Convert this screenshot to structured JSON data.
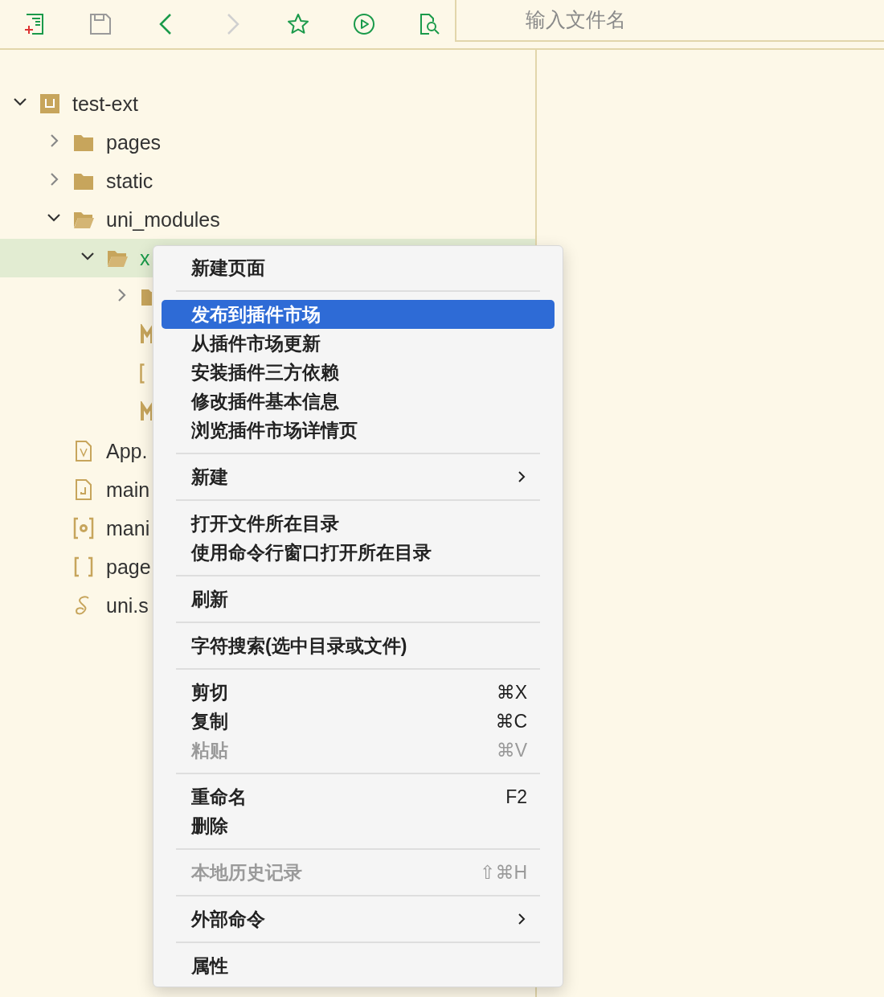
{
  "toolbar": {
    "buttons": [
      {
        "kind": "new-file",
        "disabled": false
      },
      {
        "kind": "save",
        "disabled": true
      },
      {
        "kind": "back",
        "disabled": false
      },
      {
        "kind": "forward",
        "disabled": true
      },
      {
        "kind": "star",
        "disabled": false
      },
      {
        "kind": "run",
        "disabled": false
      },
      {
        "kind": "find-file",
        "disabled": false
      }
    ],
    "search": {
      "placeholder": "输入文件名"
    }
  },
  "tree": [
    {
      "kind": "project",
      "label": "test-ext",
      "expanded": true,
      "selected": false,
      "children": [
        {
          "kind": "folder",
          "label": "pages",
          "expanded": false,
          "selected": false
        },
        {
          "kind": "folder",
          "label": "static",
          "expanded": false,
          "selected": false
        },
        {
          "kind": "folder",
          "label": "uni_modules",
          "expanded": true,
          "selected": false,
          "children": [
            {
              "kind": "folder",
              "label": "x",
              "expanded": true,
              "selected": true,
              "children": [
                {
                  "kind": "folder",
                  "expanded": false,
                  "selected": false
                },
                {
                  "kind": "markdown",
                  "selected": false
                },
                {
                  "kind": "json",
                  "selected": false
                },
                {
                  "kind": "markdown",
                  "selected": false
                }
              ]
            }
          ]
        },
        {
          "kind": "vue",
          "label": "App.",
          "selected": false
        },
        {
          "kind": "js",
          "label": "main",
          "selected": false
        },
        {
          "kind": "config",
          "label": "mani",
          "selected": false
        },
        {
          "kind": "json",
          "label": "page",
          "selected": false
        },
        {
          "kind": "style",
          "label": "uni.s",
          "selected": false
        }
      ]
    }
  ],
  "context_menu": {
    "groups": [
      [
        {
          "label": "新建页面",
          "selected": false,
          "disabled": false
        }
      ],
      [
        {
          "label": "发布到插件市场",
          "selected": true,
          "disabled": false
        },
        {
          "label": "从插件市场更新",
          "selected": false,
          "disabled": false
        },
        {
          "label": "安装插件三方依赖",
          "selected": false,
          "disabled": false
        },
        {
          "label": "修改插件基本信息",
          "selected": false,
          "disabled": false
        },
        {
          "label": "浏览插件市场详情页",
          "selected": false,
          "disabled": false
        }
      ],
      [
        {
          "label": "新建",
          "selected": false,
          "disabled": false,
          "submenu": true
        }
      ],
      [
        {
          "label": "打开文件所在目录",
          "selected": false,
          "disabled": false
        },
        {
          "label": "使用命令行窗口打开所在目录",
          "selected": false,
          "disabled": false
        }
      ],
      [
        {
          "label": "刷新",
          "selected": false,
          "disabled": false
        }
      ],
      [
        {
          "label": "字符搜索(选中目录或文件)",
          "selected": false,
          "disabled": false
        }
      ],
      [
        {
          "label": "剪切",
          "shortcut": "⌘X",
          "selected": false,
          "disabled": false
        },
        {
          "label": "复制",
          "shortcut": "⌘C",
          "selected": false,
          "disabled": false
        },
        {
          "label": "粘贴",
          "shortcut": "⌘V",
          "selected": false,
          "disabled": true
        }
      ],
      [
        {
          "label": "重命名",
          "shortcut": "F2",
          "selected": false,
          "disabled": false
        },
        {
          "label": "删除",
          "selected": false,
          "disabled": false
        }
      ],
      [
        {
          "label": "本地历史记录",
          "shortcut": "⇧⌘H",
          "selected": false,
          "disabled": true
        }
      ],
      [
        {
          "label": "外部命令",
          "selected": false,
          "disabled": false,
          "submenu": true
        }
      ],
      [
        {
          "label": "属性",
          "selected": false,
          "disabled": false
        }
      ]
    ]
  }
}
